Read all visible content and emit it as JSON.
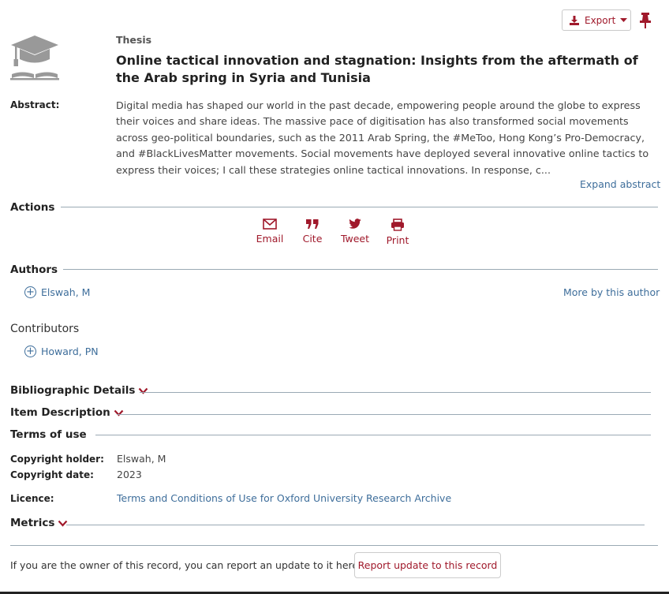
{
  "toolbar": {
    "export_label": "Export"
  },
  "record": {
    "type": "Thesis",
    "title": "Online tactical innovation and stagnation: Insights from the aftermath of the Arab spring in Syria and Tunisia",
    "abstract_label": "Abstract:",
    "abstract": "Digital media has shaped our world in the past decade, empowering people around the globe to express their voices and share ideas. The massive pace of digitisation has also transformed social movements across geo-political boundaries, such as the 2011 Arab Spring, the #MeToo, Hong Kong’s Pro-Democracy, and #BlackLivesMatter movements. Social movements have deployed several innovative online tactics to express their voices; I call these strategies online tactical innovations. In response, c...",
    "expand_label": "Expand abstract"
  },
  "actions": {
    "heading": "Actions",
    "items": [
      {
        "label": "Email",
        "icon": "envelope-icon"
      },
      {
        "label": "Cite",
        "icon": "quote-icon"
      },
      {
        "label": "Tweet",
        "icon": "twitter-icon"
      },
      {
        "label": "Print",
        "icon": "printer-icon"
      }
    ]
  },
  "authors": {
    "heading": "Authors",
    "name": "Elswah, M",
    "more_label": "More by this author"
  },
  "contributors": {
    "heading": "Contributors",
    "name": "Howard, PN"
  },
  "sections": {
    "bibliographic": "Bibliographic Details",
    "item_description": "Item Description",
    "terms": "Terms of use",
    "metrics": "Metrics"
  },
  "terms": {
    "holder_label": "Copyright holder:",
    "holder_value": "Elswah, M",
    "date_label": "Copyright date:",
    "date_value": "2023",
    "licence_label": "Licence:",
    "licence_value": "Terms and Conditions of Use for Oxford University Research Archive"
  },
  "footer": {
    "text": "If you are the owner of this record, you can report an update to it here:",
    "report_label": "Report update to this record"
  },
  "colors": {
    "accent": "#a0192b",
    "link": "#3e6e9b",
    "rule": "#9aa9b4"
  }
}
